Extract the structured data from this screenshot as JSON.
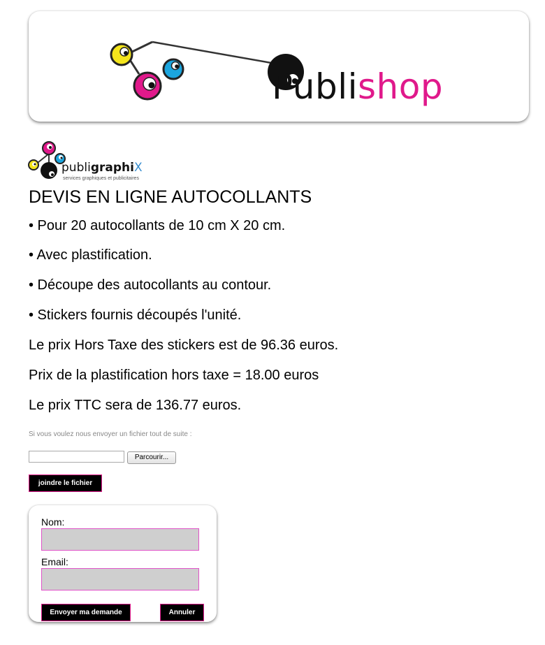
{
  "header": {
    "brand_part1": "Publi",
    "brand_part2": "shop",
    "brand_colors": {
      "dark": "#111111",
      "pink": "#e0198b",
      "yellow": "#f4e51c",
      "cyan": "#1ba5de"
    }
  },
  "logo_small": {
    "part1": "publi",
    "part2": "graphi",
    "part3": "X",
    "tagline": "services graphiques et publicitaires"
  },
  "title": "DEVIS EN LIGNE AUTOCOLLANTS",
  "lines": [
    "• Pour 20 autocollants de 10 cm X 20 cm.",
    "• Avec plastification.",
    "• Découpe des autocollants au contour.",
    "• Stickers fournis découpés l'unité.",
    "Le prix Hors Taxe des stickers est de 96.36 euros.",
    "Prix de la plastification hors taxe = 18.00 euros",
    "Le prix TTC sera de 136.77 euros."
  ],
  "upload": {
    "hint": "Si vous voulez nous envoyer un fichier tout de suite :",
    "browse_label": "Parcourir...",
    "file_value": "",
    "join_label": "joindre le fichier"
  },
  "form": {
    "name_label": "Nom:",
    "name_value": "",
    "email_label": "Email:",
    "email_value": "",
    "send_label": "Envoyer ma demande",
    "cancel_label": "Annuler"
  }
}
